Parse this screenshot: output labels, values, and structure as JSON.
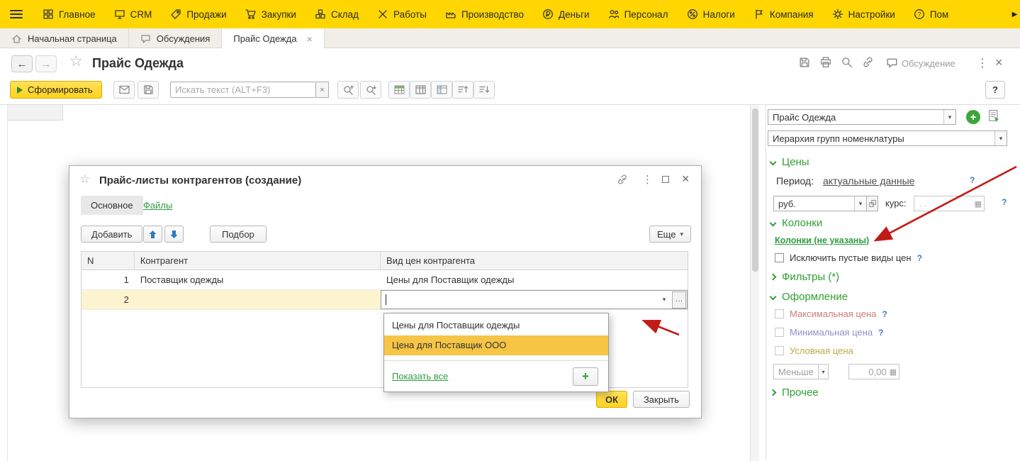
{
  "glyphs": {
    "dropdown": "▾",
    "close": "×",
    "dots": "⋮",
    "star": "☆",
    "back": "←",
    "forward": "→",
    "plus": "+",
    "question": "?",
    "ellipsis": "…",
    "overflow": "▶",
    "calc": "▦"
  },
  "top_menu": {
    "items": [
      {
        "label": "Главное"
      },
      {
        "label": "CRM"
      },
      {
        "label": "Продажи"
      },
      {
        "label": "Закупки"
      },
      {
        "label": "Склад"
      },
      {
        "label": "Работы"
      },
      {
        "label": "Производство"
      },
      {
        "label": "Деньги"
      },
      {
        "label": "Персонал"
      },
      {
        "label": "Налоги"
      },
      {
        "label": "Компания"
      },
      {
        "label": "Настройки"
      },
      {
        "label": "Пом"
      }
    ]
  },
  "tab_bar": {
    "tabs": [
      {
        "label": "Начальная страница"
      },
      {
        "label": "Обсуждения"
      },
      {
        "label": "Прайс Одежда"
      }
    ]
  },
  "form_header": {
    "title": "Прайс Одежда",
    "discussion_label": "Обсуждение"
  },
  "toolbar": {
    "generate_label": "Сформировать",
    "search_placeholder": "Искать текст (ALT+F3)"
  },
  "dialog": {
    "title": "Прайс-листы контрагентов (создание)",
    "tab_main": "Основное",
    "tab_files": "Файлы",
    "add_label": "Добавить",
    "pick_label": "Подбор",
    "more_label": "Еще",
    "columns": [
      "N",
      "Контрагент",
      "Вид цен контрагента"
    ],
    "rows": [
      {
        "n": "1",
        "contragent": "Поставщик одежды",
        "price_kind": "Цены для Поставщик одежды"
      },
      {
        "n": "2",
        "contragent": "",
        "price_kind": ""
      }
    ],
    "dropdown": {
      "items": [
        "Цены для Поставщик одежды",
        "Цена для Поставщик ООО"
      ],
      "show_all_label": "Показать все"
    },
    "ok_label": "ОК",
    "close_label": "Закрыть"
  },
  "sidebar": {
    "report_name": "Прайс Одежда",
    "grouping_value": "Иерархия групп номенклатуры",
    "sections": {
      "prices": "Цены",
      "columns": "Колонки",
      "filters": "Фильтры (*)",
      "formatting": "Оформление",
      "other": "Прочее"
    },
    "period_label": "Период:",
    "period_value": "актуальные данные",
    "currency_value": "руб.",
    "rate_label": "курс:",
    "rate_value": ".      .",
    "columns_link": "Колонки (не указаны)",
    "exclude_empty_label": "Исключить пустые виды цен",
    "max_price_label": "Максимальная цена",
    "min_price_label": "Минимальная цена",
    "conditional_price_label": "Условная цена",
    "comparison_value": "Меньше",
    "amount_value": "0,00"
  }
}
